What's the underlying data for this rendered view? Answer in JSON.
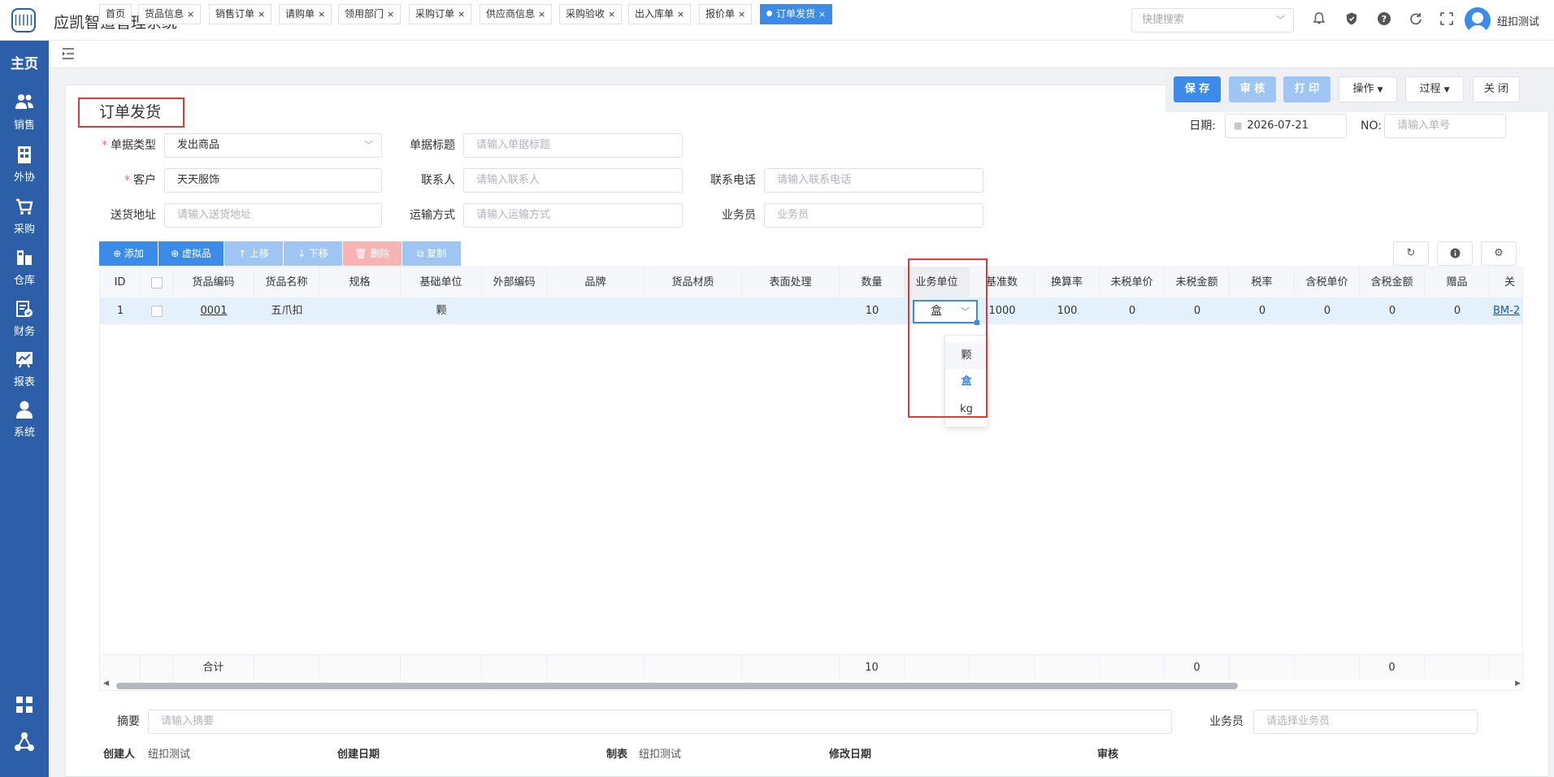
{
  "app": {
    "title": "应凯智造管理系统",
    "logo_text": "|||||"
  },
  "header": {
    "quick_search_placeholder": "快捷搜索",
    "username": "纽扣测试",
    "icons": [
      "bell-icon",
      "shield-icon",
      "help-icon",
      "refresh-icon",
      "fullscreen-icon"
    ]
  },
  "sidebar": {
    "home": "主页",
    "items": [
      {
        "label": "销售",
        "icon": "users-icon"
      },
      {
        "label": "外协",
        "icon": "building-icon"
      },
      {
        "label": "采购",
        "icon": "cart-icon"
      },
      {
        "label": "仓库",
        "icon": "warehouse-icon"
      },
      {
        "label": "财务",
        "icon": "finance-icon"
      },
      {
        "label": "报表",
        "icon": "chart-icon"
      },
      {
        "label": "系统",
        "icon": "user-icon"
      }
    ]
  },
  "tabs": [
    {
      "label": "首页"
    },
    {
      "label": "货品信息",
      "close": "×"
    },
    {
      "label": "销售订单",
      "close": "×"
    },
    {
      "label": "请购单",
      "close": "×"
    },
    {
      "label": "领用部门",
      "close": "×"
    },
    {
      "label": "采购订单",
      "close": "×"
    },
    {
      "label": "供应商信息",
      "close": "×"
    },
    {
      "label": "采购验收",
      "close": "×"
    },
    {
      "label": "出入库单",
      "close": "×"
    },
    {
      "label": "报价单",
      "close": "×"
    },
    {
      "label": "订单发货",
      "close": "×"
    }
  ],
  "actions": {
    "save": "保 存",
    "audit": "审 核",
    "print": "打 印",
    "operate": "操作",
    "process": "过程",
    "close": "关 闭"
  },
  "page_title": "订单发货",
  "header_fields": {
    "date_label": "日期:",
    "date_value": "2026-07-21",
    "no_label": "NO:",
    "no_placeholder": "请输入单号"
  },
  "form": {
    "doc_type": {
      "label": "单据类型",
      "value": "发出商品"
    },
    "doc_title": {
      "label": "单据标题",
      "placeholder": "请输入单据标题"
    },
    "customer": {
      "label": "客户",
      "value": "天天服饰"
    },
    "contact": {
      "label": "联系人",
      "placeholder": "请输入联系人"
    },
    "phone": {
      "label": "联系电话",
      "placeholder": "请输入联系电话"
    },
    "address": {
      "label": "送货地址",
      "placeholder": "请输入送货地址"
    },
    "shipping": {
      "label": "运输方式",
      "placeholder": "请输入运输方式"
    },
    "salesman": {
      "label": "业务员",
      "placeholder": "业务员"
    }
  },
  "grid_toolbar": {
    "add": "⊕ 添加",
    "virtual": "⊕ 虚拟品",
    "move_up": "↑ 上移",
    "move_down": "↓ 下移",
    "delete": "🗑 删除",
    "copy": "⧉ 复制"
  },
  "grid": {
    "columns": [
      "ID",
      "",
      "货品编码",
      "货品名称",
      "规格",
      "基础单位",
      "外部编码",
      "品牌",
      "货品材质",
      "表面处理",
      "数量",
      "业务单位",
      "基准数",
      "换算率",
      "未税单价",
      "未税金额",
      "税率",
      "含税单价",
      "含税金额",
      "赠品",
      "关"
    ],
    "rows": [
      {
        "id": "1",
        "code": "0001",
        "name": "五爪扣",
        "spec": "",
        "base_unit": "颗",
        "ext_code": "",
        "brand": "",
        "material": "",
        "surface": "",
        "qty": "10",
        "biz_unit": "盒",
        "base_num": "1000",
        "rate": "100",
        "price_ex": "0",
        "amt_ex": "0",
        "tax": "0",
        "price_in": "0",
        "amt_in": "0",
        "gift": "0",
        "ref": "BM-2"
      }
    ],
    "footer": {
      "label": "合计",
      "qty": "10",
      "amt_ex": "0",
      "amt_in": "0"
    },
    "unit_options": [
      "颗",
      "盒",
      "kg"
    ],
    "unit_selected": "盒"
  },
  "bottom": {
    "summary_label": "摘要",
    "summary_placeholder": "请输入摘要",
    "salesman_label": "业务员",
    "salesman_placeholder": "请选择业务员",
    "creator_label": "创建人",
    "creator_value": "纽扣测试",
    "create_date_label": "创建日期",
    "maker_label": "制表",
    "maker_value": "纽扣测试",
    "modify_date_label": "修改日期",
    "auditor_label": "审核"
  },
  "colors": {
    "primary": "#3d8be8",
    "sidebar": "#2c5fa8",
    "highlight": "#e53935"
  }
}
